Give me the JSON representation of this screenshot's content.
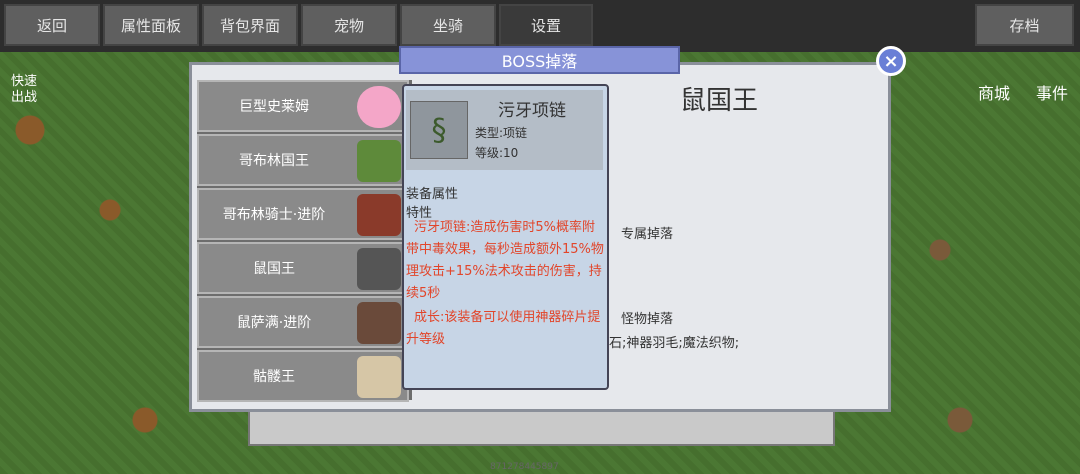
{
  "tabs": [
    "返回",
    "属性面板",
    "背包界面",
    "宠物",
    "坐骑",
    "设置"
  ],
  "save_label": "存档",
  "side": {
    "quick_battle": "快速\n出战",
    "shop": "商城",
    "events": "事件"
  },
  "dialog": {
    "title": "BOSS掉落",
    "close_icon": "×",
    "boss_name": "鼠国王",
    "drop_exclusive": "专属掉落",
    "drop_monster": "怪物掉落",
    "drop_monster_items": "石;神器羽毛;魔法织物;"
  },
  "bosses": [
    {
      "name": "巨型史莱姆",
      "color": "#f4a6c8"
    },
    {
      "name": "哥布林国王",
      "color": "#5e8a3a"
    },
    {
      "name": "哥布林骑士·进阶",
      "color": "#8a3a2a"
    },
    {
      "name": "鼠国王",
      "color": "#555555"
    },
    {
      "name": "鼠萨满·进阶",
      "color": "#6a4a3a"
    },
    {
      "name": "骷髅王",
      "color": "#d6c6a6"
    }
  ],
  "tooltip": {
    "item_name": "污牙项链",
    "type": "类型:项链",
    "level": "等级:10",
    "section_attr": "装备属性",
    "section_trait": "特性",
    "trait_text": "污牙项链:造成伤害时5%概率附带中毒效果，每秒造成额外15%物理攻击+15%法术攻击的伤害，持续5秒",
    "growth_text": "成长:该装备可以使用神器碎片提升等级"
  },
  "footer_id": "871278445897"
}
